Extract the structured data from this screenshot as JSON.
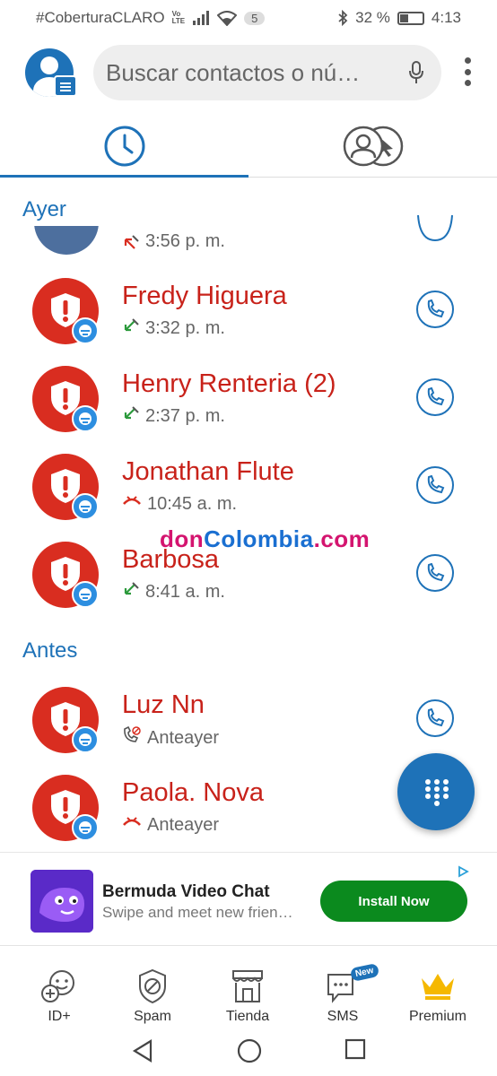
{
  "status_bar": {
    "carrier": "#CoberturaCLARO",
    "volte_top": "Vo",
    "volte_bottom": "LTE",
    "sim_count": "5",
    "battery": "32 %",
    "time": "4:13"
  },
  "header": {
    "search_placeholder": "Buscar contactos o nú…"
  },
  "tabs": [
    {
      "name": "recents",
      "active": true
    },
    {
      "name": "contacts",
      "active": false
    }
  ],
  "sections": {
    "yesterday": "Ayer",
    "before": "Antes"
  },
  "partial_call": {
    "time": "3:56 p. m.",
    "call_type": "missed"
  },
  "calls": [
    {
      "name": "Fredy Higuera",
      "time": "3:32 p. m.",
      "call_type": "incoming"
    },
    {
      "name": "Henry Renteria",
      "count": "(2)",
      "time": "2:37 p. m.",
      "call_type": "incoming"
    },
    {
      "name": "Jonathan Flute",
      "time": "10:45 a. m.",
      "call_type": "rejected"
    },
    {
      "name": "Barbosa",
      "time": "8:41 a. m.",
      "call_type": "incoming"
    },
    {
      "name": "Luz Nn",
      "time": "Anteayer",
      "call_type": "blocked"
    },
    {
      "name": "Paola. Nova",
      "time": "Anteayer",
      "call_type": "rejected"
    }
  ],
  "watermark": {
    "parts": [
      "don",
      "Colombia",
      ".com"
    ],
    "colors": [
      "#d4146f",
      "#1a6fd1",
      "#d4146f"
    ]
  },
  "ad": {
    "title": "Bermuda Video Chat",
    "subtitle": "Swipe and meet new frien…",
    "cta": "Install Now"
  },
  "bottom_nav": [
    {
      "label": "ID+",
      "icon": "id-plus-icon"
    },
    {
      "label": "Spam",
      "icon": "spam-shield-icon"
    },
    {
      "label": "Tienda",
      "icon": "store-icon"
    },
    {
      "label": "SMS",
      "icon": "sms-icon",
      "badge": "New"
    },
    {
      "label": "Premium",
      "icon": "crown-icon"
    }
  ],
  "colors": {
    "accent": "#1e72b8",
    "spam_red": "#d92d20",
    "name_red": "#c8221a",
    "cta_green": "#0b8a1e"
  }
}
